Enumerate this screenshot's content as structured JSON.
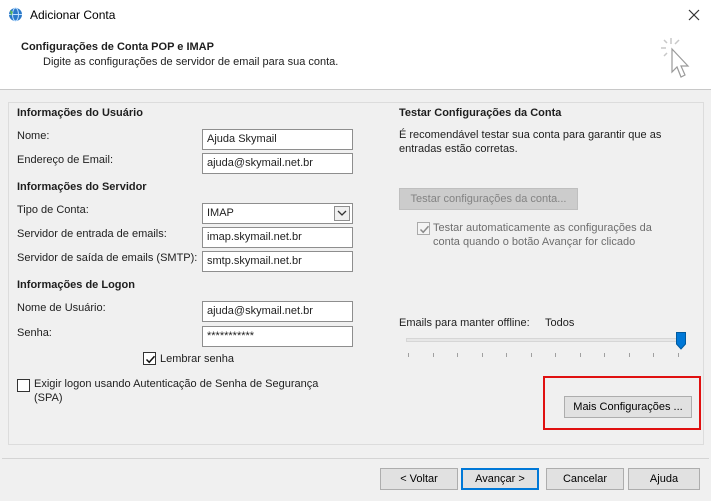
{
  "window": {
    "title": "Adicionar Conta",
    "header_title": "Configurações de Conta POP e IMAP",
    "header_subtitle": "Digite as configurações de servidor de email para sua conta."
  },
  "user_info": {
    "section_label": "Informações do Usuário",
    "name_label": "Nome:",
    "name_value": "Ajuda Skymail",
    "email_label": "Endereço de Email:",
    "email_value": "ajuda@skymail.net.br"
  },
  "server_info": {
    "section_label": "Informações do Servidor",
    "account_type_label": "Tipo de Conta:",
    "account_type_value": "IMAP",
    "incoming_label": "Servidor de entrada de emails:",
    "incoming_value": "imap.skymail.net.br",
    "outgoing_label": "Servidor de saída de emails (SMTP):",
    "outgoing_value": "smtp.skymail.net.br"
  },
  "logon_info": {
    "section_label": "Informações de Logon",
    "username_label": "Nome de Usuário:",
    "username_value": "ajuda@skymail.net.br",
    "password_label": "Senha:",
    "password_value": "***********",
    "remember_label": "Lembrar senha",
    "remember_checked": true,
    "spa_label_line1": "Exigir logon usando Autenticação de Senha de Segurança",
    "spa_label_line2": "(SPA)",
    "spa_checked": false
  },
  "test_settings": {
    "section_label": "Testar Configurações da Conta",
    "description_line1": "É recomendável testar sua conta para garantir que as",
    "description_line2": "entradas estão corretas.",
    "test_button": "Testar configurações da conta...",
    "auto_test_line1": "Testar automaticamente as configurações da",
    "auto_test_line2": "conta quando o botão Avançar for clicado",
    "auto_test_checked": true
  },
  "offline": {
    "label": "Emails para manter offline:",
    "value": "Todos",
    "level_fraction": 1.0
  },
  "more_settings_button": "Mais Configurações ...",
  "footer": {
    "back": "< Voltar",
    "next": "Avançar >",
    "cancel": "Cancelar",
    "help": "Ajuda"
  },
  "colors": {
    "highlight": "#e01010",
    "accent": "#0078d7",
    "background": "#f0f0f0"
  }
}
